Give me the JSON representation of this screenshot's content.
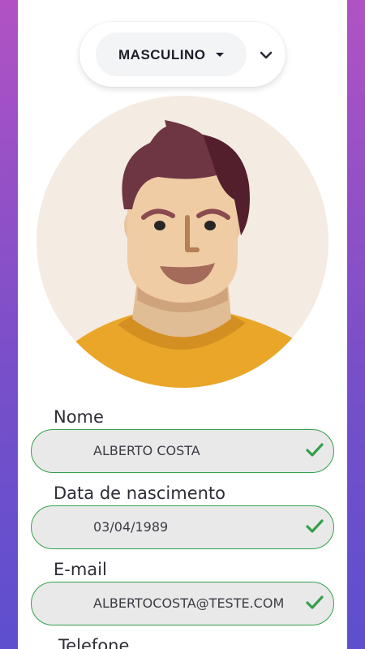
{
  "gender": {
    "selected": "MASCULINO",
    "caret_icon": "caret-down-icon",
    "chevron_icon": "chevron-down-icon"
  },
  "avatar": {
    "icon": "male-avatar-illustration"
  },
  "fields": {
    "name": {
      "label": "Nome",
      "value": "ALBERTO COSTA",
      "status_icon": "check-icon"
    },
    "birthdate": {
      "label": "Data de nascimento",
      "value": "03/04/1989",
      "status_icon": "check-icon"
    },
    "email": {
      "label": "E-mail",
      "value": "ALBERTOCOSTA@TESTE.COM",
      "status_icon": "check-icon"
    },
    "phone": {
      "label": "Telefone"
    }
  },
  "colors": {
    "valid": "#34a04a",
    "gradient_top": "#b152c4",
    "gradient_bottom": "#5d4fcf"
  }
}
